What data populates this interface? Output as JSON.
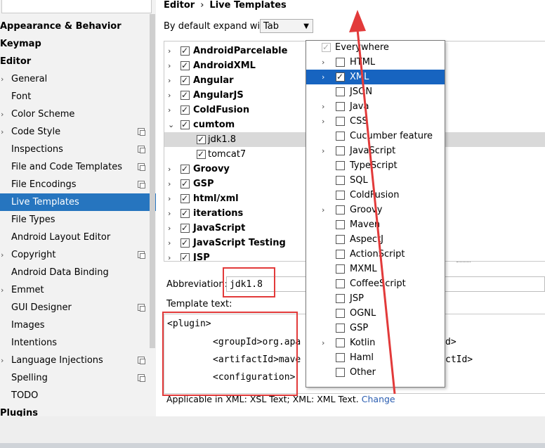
{
  "sidebar": {
    "items": [
      {
        "label": "Appearance & Behavior",
        "level": "top",
        "arrow": false,
        "copy": false
      },
      {
        "label": "Keymap",
        "level": "top",
        "arrow": false,
        "copy": false
      },
      {
        "label": "Editor",
        "level": "top",
        "arrow": false,
        "copy": false
      },
      {
        "label": "General",
        "level": "sub",
        "arrow": true,
        "copy": false
      },
      {
        "label": "Font",
        "level": "sub",
        "arrow": false,
        "copy": false
      },
      {
        "label": "Color Scheme",
        "level": "sub",
        "arrow": true,
        "copy": false
      },
      {
        "label": "Code Style",
        "level": "sub",
        "arrow": true,
        "copy": true
      },
      {
        "label": "Inspections",
        "level": "sub",
        "arrow": false,
        "copy": true
      },
      {
        "label": "File and Code Templates",
        "level": "sub",
        "arrow": false,
        "copy": true
      },
      {
        "label": "File Encodings",
        "level": "sub",
        "arrow": false,
        "copy": true
      },
      {
        "label": "Live Templates",
        "level": "sub",
        "arrow": false,
        "copy": false,
        "selected": true
      },
      {
        "label": "File Types",
        "level": "sub",
        "arrow": false,
        "copy": false
      },
      {
        "label": "Android Layout Editor",
        "level": "sub",
        "arrow": false,
        "copy": false
      },
      {
        "label": "Copyright",
        "level": "sub",
        "arrow": true,
        "copy": true
      },
      {
        "label": "Android Data Binding",
        "level": "sub",
        "arrow": false,
        "copy": false
      },
      {
        "label": "Emmet",
        "level": "sub",
        "arrow": true,
        "copy": false
      },
      {
        "label": "GUI Designer",
        "level": "sub",
        "arrow": false,
        "copy": true
      },
      {
        "label": "Images",
        "level": "sub",
        "arrow": false,
        "copy": false
      },
      {
        "label": "Intentions",
        "level": "sub",
        "arrow": false,
        "copy": false
      },
      {
        "label": "Language Injections",
        "level": "sub",
        "arrow": true,
        "copy": true
      },
      {
        "label": "Spelling",
        "level": "sub",
        "arrow": false,
        "copy": true
      },
      {
        "label": "TODO",
        "level": "sub",
        "arrow": false,
        "copy": false
      },
      {
        "label": "Plugins",
        "level": "top",
        "arrow": false,
        "copy": false
      }
    ]
  },
  "header": {
    "breadcrumb_root": "Editor",
    "breadcrumb_sep": "›",
    "breadcrumb_page": "Live Templates",
    "expand_label": "By default expand with",
    "expand_value": "Tab"
  },
  "tree": {
    "rows": [
      {
        "label": "AndroidParcelable",
        "arrow": "›",
        "checked": true,
        "child": false
      },
      {
        "label": "AndroidXML",
        "arrow": "›",
        "checked": true,
        "child": false
      },
      {
        "label": "Angular",
        "arrow": "›",
        "checked": true,
        "child": false
      },
      {
        "label": "AngularJS",
        "arrow": "›",
        "checked": true,
        "child": false
      },
      {
        "label": "ColdFusion",
        "arrow": "›",
        "checked": true,
        "child": false
      },
      {
        "label": "cumtom",
        "arrow": "⌄",
        "checked": true,
        "child": false
      },
      {
        "label": "jdk1.8",
        "arrow": "",
        "checked": true,
        "child": true,
        "highlight": true
      },
      {
        "label": "tomcat7",
        "arrow": "",
        "checked": true,
        "child": true
      },
      {
        "label": "Groovy",
        "arrow": "›",
        "checked": true,
        "child": false
      },
      {
        "label": "GSP",
        "arrow": "›",
        "checked": true,
        "child": false
      },
      {
        "label": "html/xml",
        "arrow": "›",
        "checked": true,
        "child": false
      },
      {
        "label": "iterations",
        "arrow": "›",
        "checked": true,
        "child": false
      },
      {
        "label": "JavaScript",
        "arrow": "›",
        "checked": true,
        "child": false
      },
      {
        "label": "JavaScript Testing",
        "arrow": "›",
        "checked": true,
        "child": false
      },
      {
        "label": "JSP",
        "arrow": "›",
        "checked": true,
        "child": false
      }
    ]
  },
  "abbreviation": {
    "label": "Abbreviation:",
    "value": "jdk1.8"
  },
  "template_text": {
    "label": "Template text:",
    "lines": [
      "<plugin>",
      "<groupId>org.apa",
      "<artifactId>mave",
      "<configuration>"
    ],
    "right_fragments": [
      "d>",
      "ctId>"
    ]
  },
  "applicable": {
    "text": "Applicable in XML: XSL Text; XML: XML Text.",
    "link": "Change"
  },
  "context_menu": {
    "items": [
      {
        "label": "Everywhere",
        "arrow": false,
        "checked": true,
        "disabled": true
      },
      {
        "label": "HTML",
        "arrow": true,
        "checked": false
      },
      {
        "label": "XML",
        "arrow": true,
        "checked": true,
        "selected": true
      },
      {
        "label": "JSON",
        "arrow": false,
        "checked": false
      },
      {
        "label": "Java",
        "arrow": true,
        "checked": false
      },
      {
        "label": "CSS",
        "arrow": true,
        "checked": false
      },
      {
        "label": "Cucumber feature",
        "arrow": false,
        "checked": false
      },
      {
        "label": "JavaScript",
        "arrow": true,
        "checked": false
      },
      {
        "label": "TypeScript",
        "arrow": false,
        "checked": false
      },
      {
        "label": "SQL",
        "arrow": false,
        "checked": false
      },
      {
        "label": "ColdFusion",
        "arrow": false,
        "checked": false
      },
      {
        "label": "Groovy",
        "arrow": true,
        "checked": false
      },
      {
        "label": "Maven",
        "arrow": false,
        "checked": false
      },
      {
        "label": "AspectJ",
        "arrow": false,
        "checked": false
      },
      {
        "label": "ActionScript",
        "arrow": false,
        "checked": false
      },
      {
        "label": "MXML",
        "arrow": false,
        "checked": false
      },
      {
        "label": "CoffeeScript",
        "arrow": false,
        "checked": false
      },
      {
        "label": "JSP",
        "arrow": false,
        "checked": false
      },
      {
        "label": "OGNL",
        "arrow": false,
        "checked": false
      },
      {
        "label": "GSP",
        "arrow": false,
        "checked": false
      },
      {
        "label": "Kotlin",
        "arrow": true,
        "checked": false
      },
      {
        "label": "Haml",
        "arrow": false,
        "checked": false
      },
      {
        "label": "Other",
        "arrow": false,
        "checked": false
      }
    ]
  },
  "colors": {
    "selection": "#2675bf",
    "menu_selection": "#1764c0",
    "annotation": "#e23a3a",
    "link": "#2a5db0"
  }
}
